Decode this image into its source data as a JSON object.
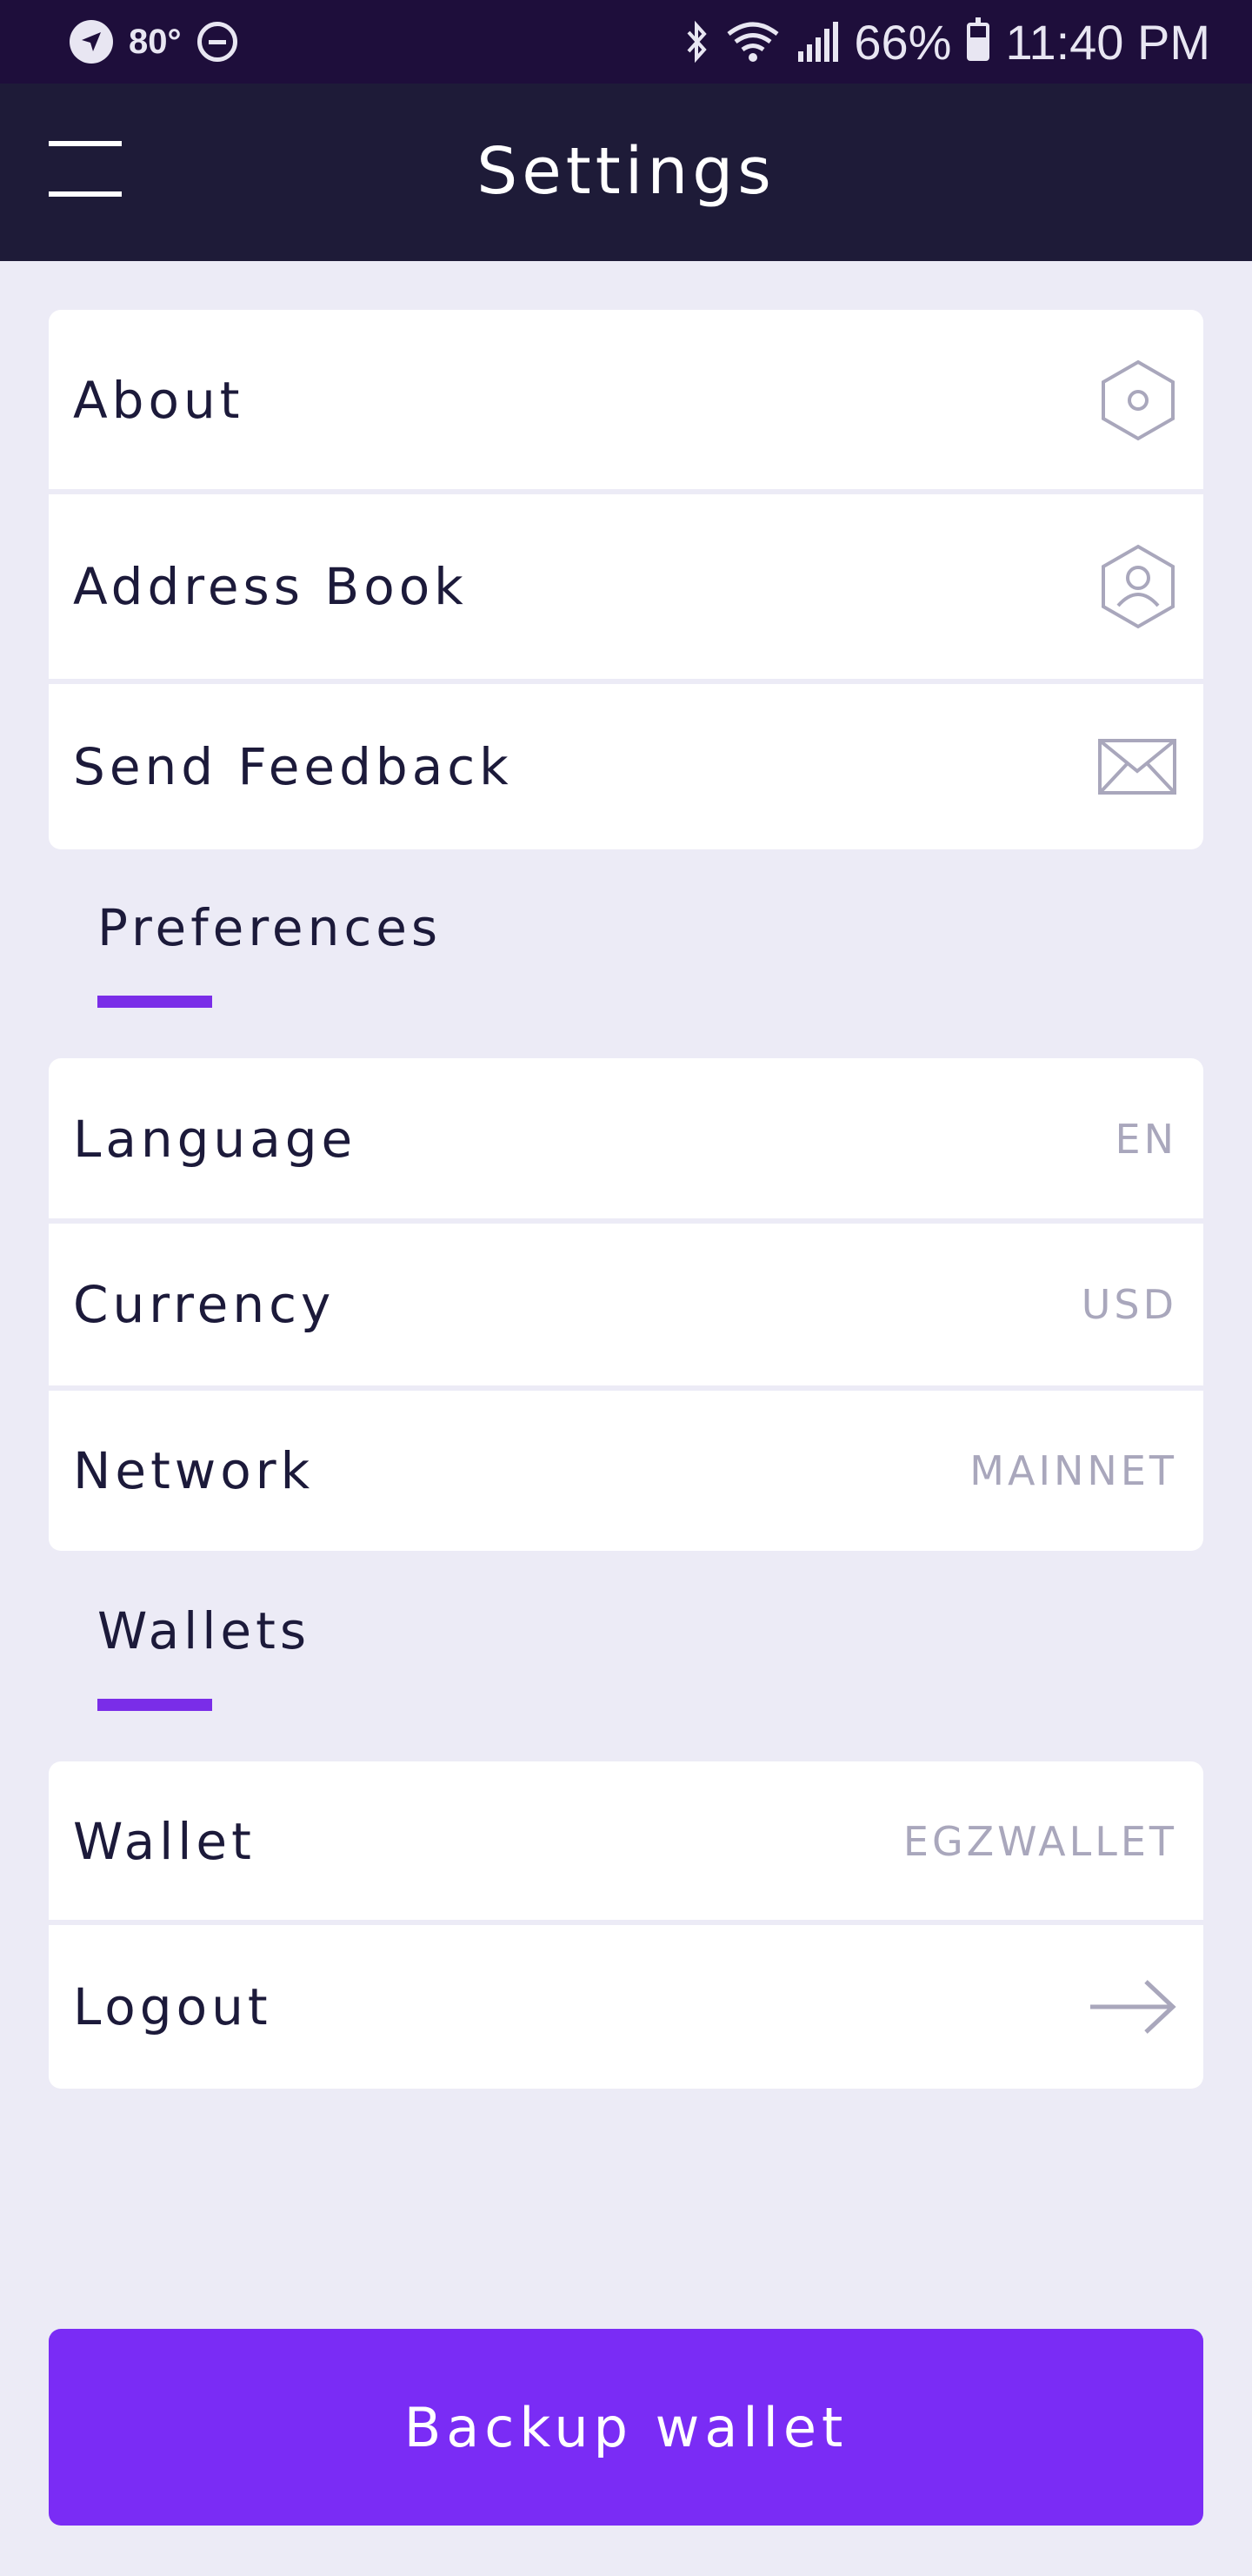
{
  "status_bar": {
    "temperature": "80°",
    "battery": "66%",
    "time": "11:40 PM"
  },
  "header": {
    "title": "Settings"
  },
  "general": {
    "items": [
      {
        "label": "About",
        "icon": "hexagon-icon"
      },
      {
        "label": "Address Book",
        "icon": "contact-hexagon-icon"
      },
      {
        "label": "Send Feedback",
        "icon": "mail-icon"
      }
    ]
  },
  "preferences": {
    "title": "Preferences",
    "items": [
      {
        "label": "Language",
        "value": "EN"
      },
      {
        "label": "Currency",
        "value": "USD"
      },
      {
        "label": "Network",
        "value": "MAINNET"
      }
    ]
  },
  "wallets": {
    "title": "Wallets",
    "items": [
      {
        "label": "Wallet",
        "value": "EGZWALLET"
      },
      {
        "label": "Logout",
        "icon": "arrow-right-icon"
      }
    ]
  },
  "backup_button": {
    "label": "Backup wallet"
  },
  "colors": {
    "accent": "#7a2cf5",
    "header_bg": "#1e1b38",
    "status_bar_bg": "#1e0e3b",
    "page_bg": "#ecebf6",
    "muted_text": "#a9a7bc"
  }
}
